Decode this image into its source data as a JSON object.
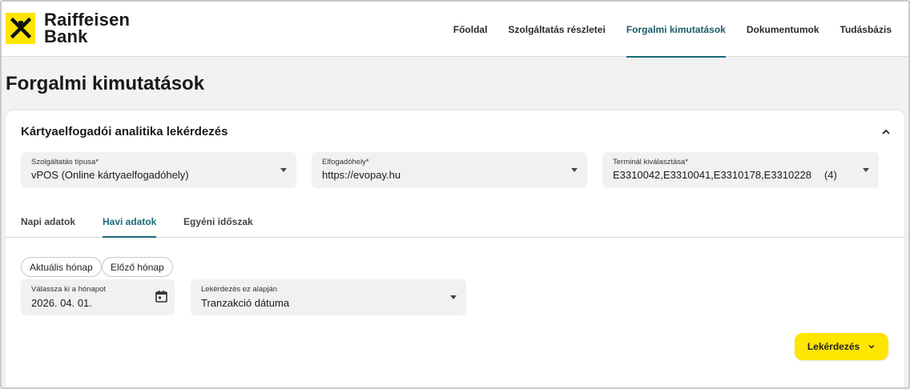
{
  "brand": {
    "name_line1": "Raiffeisen",
    "name_line2": "Bank",
    "accent": "#fee600",
    "logo_icon": "raiffeisen-gable-cross-icon"
  },
  "nav": {
    "items": [
      {
        "label": "Főoldal",
        "active": false
      },
      {
        "label": "Szolgáltatás részletei",
        "active": false
      },
      {
        "label": "Forgalmi kimutatások",
        "active": true
      },
      {
        "label": "Dokumentumok",
        "active": false
      },
      {
        "label": "Tudásbázis",
        "active": false
      }
    ],
    "active_color": "#1a6a7a"
  },
  "page": {
    "title": "Forgalmi kimutatások"
  },
  "card": {
    "title": "Kártyaelfogadói analitika lekérdezés",
    "collapse_icon": "chevron-up-icon",
    "filters": {
      "service_type": {
        "label": "Szolgáltatás típusa*",
        "value": "vPOS (Online kártyaelfogadóhely)"
      },
      "acceptance_point": {
        "label": "Elfogadóhely*",
        "value": "https://evopay.hu"
      },
      "terminal": {
        "label": "Terminál kiválasztása*",
        "value": "E3310042,E3310041,E3310178,E3310228",
        "count": "(4)"
      }
    },
    "tabs": [
      {
        "label": "Napi adatok",
        "active": false
      },
      {
        "label": "Havi adatok",
        "active": true
      },
      {
        "label": "Egyéni időszak",
        "active": false
      }
    ],
    "quick_chips": {
      "current_month": "Aktuális hónap",
      "previous_month": "Előző hónap"
    },
    "month_picker": {
      "label": "Válassza ki a hónapot",
      "value": "2026. 04. 01.",
      "icon": "calendar-icon"
    },
    "query_basis": {
      "label": "Lekérdezés ez alapján",
      "value": "Tranzakció dátuma"
    },
    "query_button": {
      "label": "Lekérdezés",
      "icon": "chevron-down-icon"
    }
  }
}
